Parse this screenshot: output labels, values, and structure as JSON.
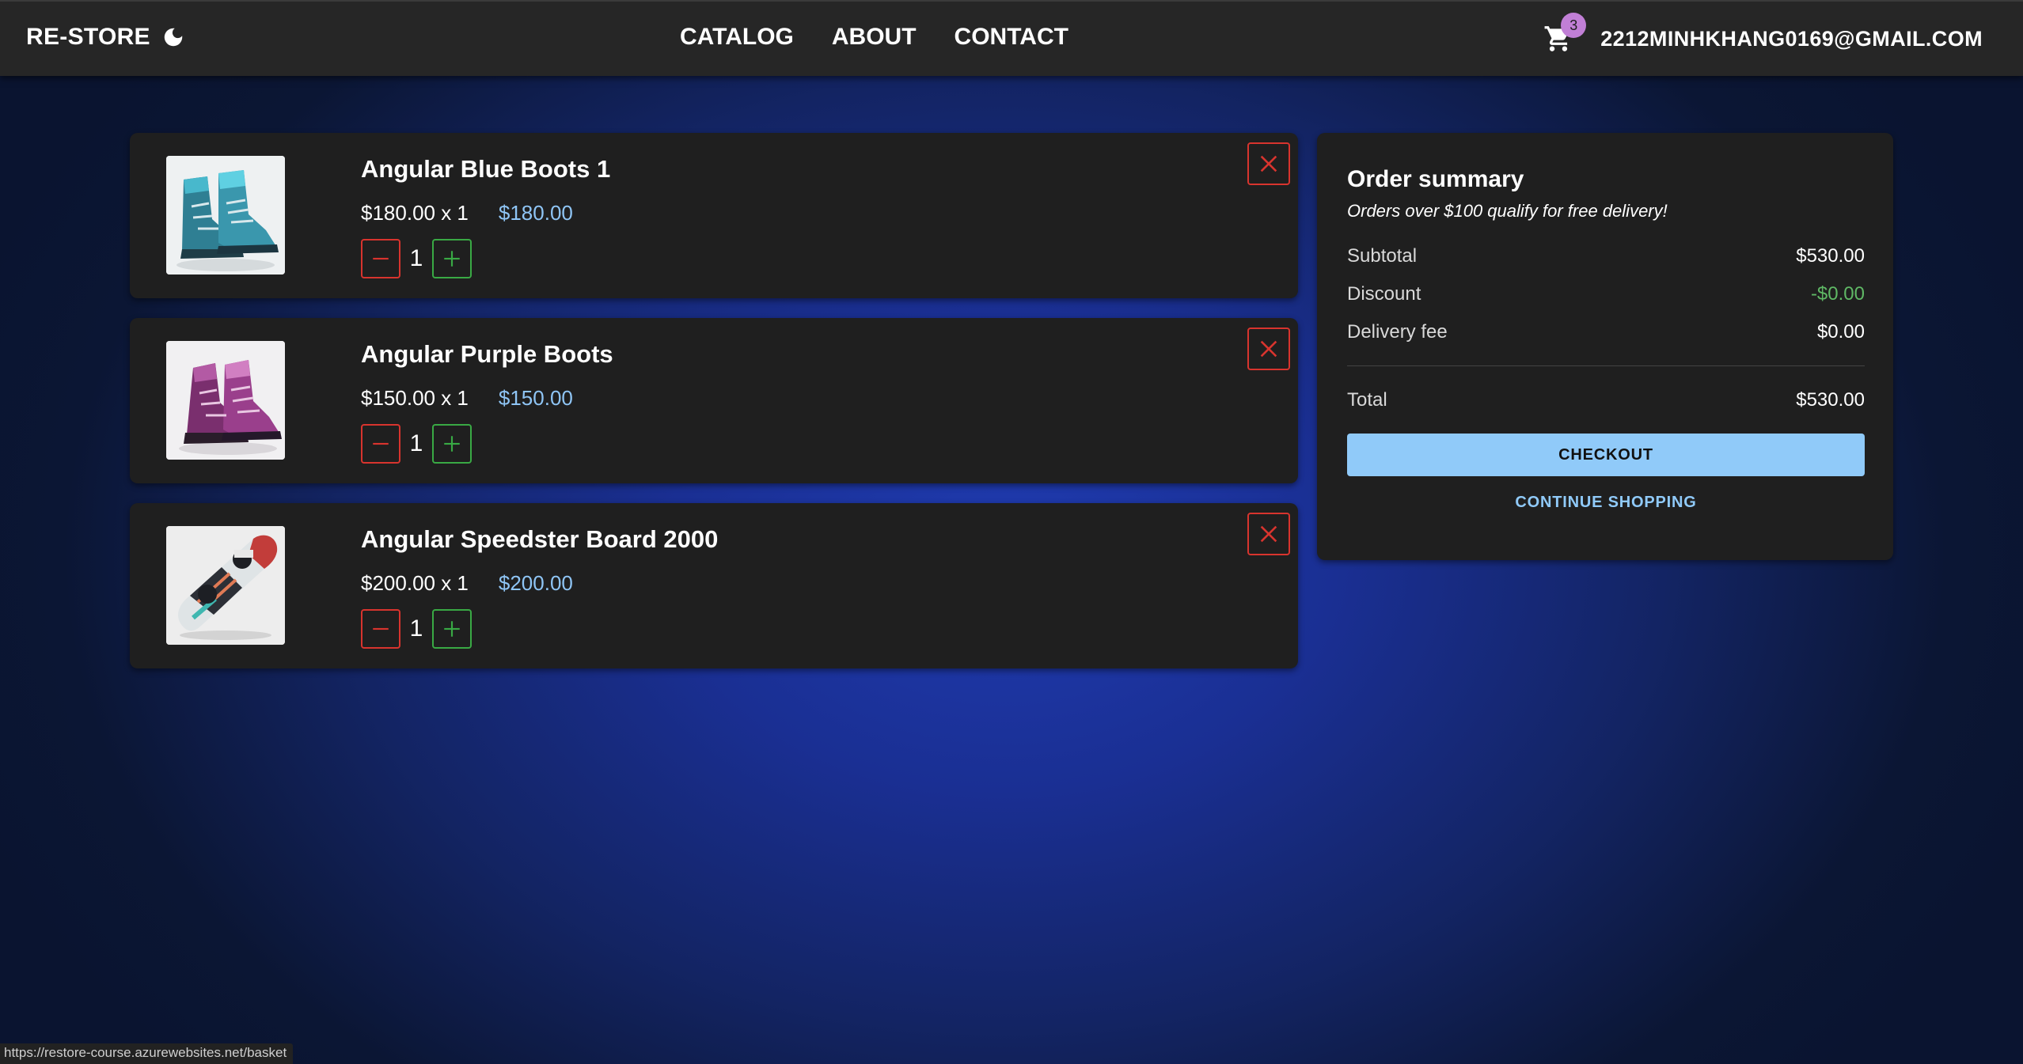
{
  "header": {
    "brand": "RE-STORE",
    "nav": [
      "CATALOG",
      "ABOUT",
      "CONTACT"
    ],
    "cart_count": "3",
    "user_email": "2212MINHKHANG0169@GMAIL.COM"
  },
  "basket": {
    "items": [
      {
        "name": "Angular Blue Boots 1",
        "unit_line": "$180.00 x 1",
        "line_total": "$180.00",
        "quantity": "1",
        "image": "blue-snowboard-boots"
      },
      {
        "name": "Angular Purple Boots",
        "unit_line": "$150.00 x 1",
        "line_total": "$150.00",
        "quantity": "1",
        "image": "purple-snowboard-boots"
      },
      {
        "name": "Angular Speedster Board 2000",
        "unit_line": "$200.00 x 1",
        "line_total": "$200.00",
        "quantity": "1",
        "image": "snowboard"
      }
    ]
  },
  "summary": {
    "title": "Order summary",
    "note": "Orders over $100 qualify for free delivery!",
    "subtotal_label": "Subtotal",
    "subtotal_value": "$530.00",
    "discount_label": "Discount",
    "discount_value": "-$0.00",
    "delivery_label": "Delivery fee",
    "delivery_value": "$0.00",
    "total_label": "Total",
    "total_value": "$530.00",
    "checkout_label": "CHECKOUT",
    "continue_label": "CONTINUE SHOPPING"
  },
  "status_bar": {
    "url": "https://restore-course.azurewebsites.net/basket"
  },
  "colors": {
    "accent": "#90caf9",
    "danger": "#d8342e",
    "success": "#39a944",
    "badge": "#c17fd6"
  }
}
